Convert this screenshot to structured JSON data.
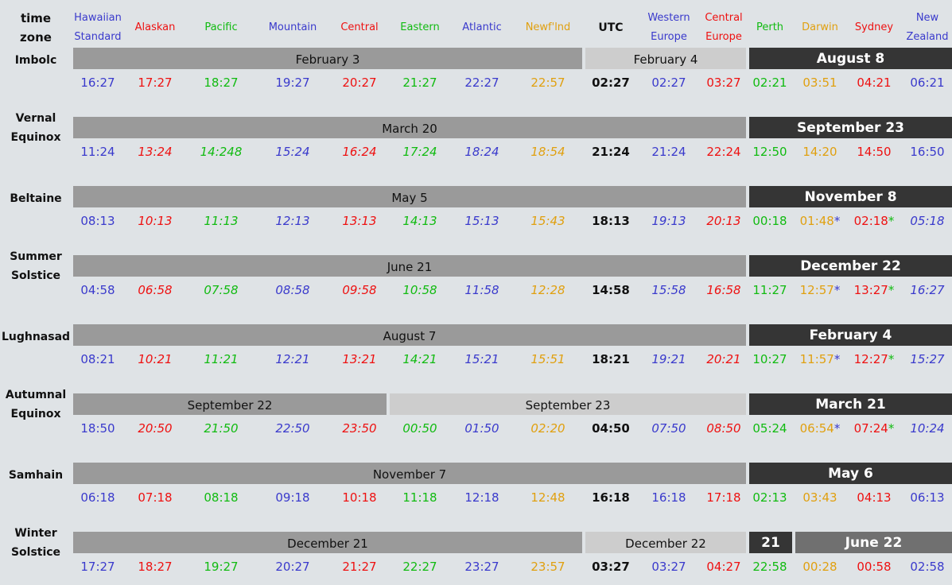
{
  "header": {
    "timezone_label": [
      "time",
      "zone"
    ],
    "columns": [
      {
        "lines": [
          "Hawaiian",
          "Standard"
        ],
        "color": "#3a3acc"
      },
      {
        "lines": [
          "Alaskan"
        ],
        "color": "#ee1111"
      },
      {
        "lines": [
          "Pacific"
        ],
        "color": "#11bb11"
      },
      {
        "lines": [
          "Mountain"
        ],
        "color": "#3a3acc"
      },
      {
        "lines": [
          "Central"
        ],
        "color": "#ee1111"
      },
      {
        "lines": [
          "Eastern"
        ],
        "color": "#11bb11"
      },
      {
        "lines": [
          "Atlantic"
        ],
        "color": "#3a3acc"
      },
      {
        "lines": [
          "Newf'lnd"
        ],
        "color": "#e0a010"
      },
      {
        "lines": [
          "UTC"
        ],
        "color": "#111111"
      },
      {
        "lines": [
          "Western",
          "Europe"
        ],
        "color": "#3a3acc"
      },
      {
        "lines": [
          "Central",
          "Europe"
        ],
        "color": "#ee1111"
      },
      {
        "lines": [
          "Perth"
        ],
        "color": "#11bb11"
      },
      {
        "lines": [
          "Darwin"
        ],
        "color": "#e0a010"
      },
      {
        "lines": [
          "Sydney"
        ],
        "color": "#ee1111"
      },
      {
        "lines": [
          "New",
          "Zealand"
        ],
        "color": "#3a3acc"
      }
    ]
  },
  "colors": {
    "background": "#dfe3e6",
    "bar_mid": "#9a9a9a",
    "bar_light": "#cdcdcd",
    "bar_dark": "#353535",
    "bar_darkmid": "#707070"
  },
  "rows": [
    {
      "label": [
        "Imbolc"
      ],
      "bars": [
        {
          "text": "February 3",
          "style": "mid",
          "span": [
            0,
            7
          ]
        },
        {
          "text": "February 4",
          "style": "light",
          "span": [
            8,
            10
          ]
        },
        {
          "text": "August 8",
          "style": "dark",
          "span": [
            11,
            14
          ]
        }
      ],
      "times": [
        {
          "t": "16:27"
        },
        {
          "t": "17:27"
        },
        {
          "t": "18:27"
        },
        {
          "t": "19:27"
        },
        {
          "t": "20:27"
        },
        {
          "t": "21:27"
        },
        {
          "t": "22:27"
        },
        {
          "t": "22:57"
        },
        {
          "t": "02:27"
        },
        {
          "t": "02:27"
        },
        {
          "t": "03:27"
        },
        {
          "t": "02:21"
        },
        {
          "t": "03:51"
        },
        {
          "t": "04:21"
        },
        {
          "t": "06:21"
        }
      ]
    },
    {
      "label": [
        "Vernal",
        "Equinox"
      ],
      "bars": [
        {
          "text": "March 20",
          "style": "mid",
          "span": [
            0,
            10
          ]
        },
        {
          "text": "September 23",
          "style": "dark",
          "span": [
            11,
            14
          ]
        }
      ],
      "times": [
        {
          "t": "11:24"
        },
        {
          "t": "13:24",
          "i": true
        },
        {
          "t": "14:248",
          "i": true
        },
        {
          "t": "15:24",
          "i": true
        },
        {
          "t": "16:24",
          "i": true
        },
        {
          "t": "17:24",
          "i": true
        },
        {
          "t": "18:24",
          "i": true
        },
        {
          "t": "18:54",
          "i": true
        },
        {
          "t": "21:24"
        },
        {
          "t": "21:24"
        },
        {
          "t": "22:24"
        },
        {
          "t": "12:50"
        },
        {
          "t": "14:20"
        },
        {
          "t": "14:50"
        },
        {
          "t": "16:50"
        }
      ]
    },
    {
      "label": [
        "Beltaine"
      ],
      "bars": [
        {
          "text": "May 5",
          "style": "mid",
          "span": [
            0,
            10
          ]
        },
        {
          "text": "November 8",
          "style": "dark",
          "span": [
            11,
            14
          ]
        }
      ],
      "times": [
        {
          "t": "08:13"
        },
        {
          "t": "10:13",
          "i": true
        },
        {
          "t": "11:13",
          "i": true
        },
        {
          "t": "12:13",
          "i": true
        },
        {
          "t": "13:13",
          "i": true
        },
        {
          "t": "14:13",
          "i": true
        },
        {
          "t": "15:13",
          "i": true
        },
        {
          "t": "15:43",
          "i": true
        },
        {
          "t": "18:13"
        },
        {
          "t": "19:13",
          "i": true
        },
        {
          "t": "20:13",
          "i": true
        },
        {
          "t": "00:18"
        },
        {
          "t": "01:48",
          "s": "*",
          "sc": "#3a3acc"
        },
        {
          "t": "02:18",
          "s": "*",
          "sc": "#11bb11"
        },
        {
          "t": "05:18",
          "i": true
        }
      ]
    },
    {
      "label": [
        "Summer",
        "Solstice"
      ],
      "bars": [
        {
          "text": "June 21",
          "style": "mid",
          "span": [
            0,
            10
          ]
        },
        {
          "text": "December 22",
          "style": "dark",
          "span": [
            11,
            14
          ]
        }
      ],
      "times": [
        {
          "t": "04:58"
        },
        {
          "t": "06:58",
          "i": true
        },
        {
          "t": "07:58",
          "i": true
        },
        {
          "t": "08:58",
          "i": true
        },
        {
          "t": "09:58",
          "i": true
        },
        {
          "t": "10:58",
          "i": true
        },
        {
          "t": "11:58",
          "i": true
        },
        {
          "t": "12:28",
          "i": true
        },
        {
          "t": "14:58"
        },
        {
          "t": "15:58",
          "i": true
        },
        {
          "t": "16:58",
          "i": true
        },
        {
          "t": "11:27"
        },
        {
          "t": "12:57",
          "s": "*",
          "sc": "#3a3acc"
        },
        {
          "t": "13:27",
          "s": "*",
          "sc": "#11bb11"
        },
        {
          "t": "16:27",
          "i": true
        }
      ]
    },
    {
      "label": [
        "Lughnasad"
      ],
      "bars": [
        {
          "text": "August 7",
          "style": "mid",
          "span": [
            0,
            10
          ]
        },
        {
          "text": "February 4",
          "style": "dark",
          "span": [
            11,
            14
          ]
        }
      ],
      "times": [
        {
          "t": "08:21"
        },
        {
          "t": "10:21",
          "i": true
        },
        {
          "t": "11:21",
          "i": true
        },
        {
          "t": "12:21",
          "i": true
        },
        {
          "t": "13:21",
          "i": true
        },
        {
          "t": "14:21",
          "i": true
        },
        {
          "t": "15:21",
          "i": true
        },
        {
          "t": "15:51",
          "i": true
        },
        {
          "t": "18:21"
        },
        {
          "t": "19:21",
          "i": true
        },
        {
          "t": "20:21",
          "i": true
        },
        {
          "t": "10:27"
        },
        {
          "t": "11:57",
          "s": "*",
          "sc": "#3a3acc"
        },
        {
          "t": "12:27",
          "s": "*",
          "sc": "#11bb11"
        },
        {
          "t": "15:27",
          "i": true
        }
      ]
    },
    {
      "label": [
        "Autumnal",
        "Equinox"
      ],
      "bars": [
        {
          "text": "September 22",
          "style": "mid",
          "span": [
            0,
            4
          ]
        },
        {
          "text": "September 23",
          "style": "light",
          "span": [
            5,
            10
          ]
        },
        {
          "text": "March 21",
          "style": "dark",
          "span": [
            11,
            14
          ]
        }
      ],
      "times": [
        {
          "t": "18:50"
        },
        {
          "t": "20:50",
          "i": true
        },
        {
          "t": "21:50",
          "i": true
        },
        {
          "t": "22:50",
          "i": true
        },
        {
          "t": "23:50",
          "i": true
        },
        {
          "t": "00:50",
          "i": true
        },
        {
          "t": "01:50",
          "i": true
        },
        {
          "t": "02:20",
          "i": true
        },
        {
          "t": "04:50"
        },
        {
          "t": "07:50",
          "i": true
        },
        {
          "t": "08:50",
          "i": true
        },
        {
          "t": "05:24"
        },
        {
          "t": "06:54",
          "s": "*",
          "sc": "#3a3acc"
        },
        {
          "t": "07:24",
          "s": "*",
          "sc": "#11bb11"
        },
        {
          "t": "10:24",
          "i": true
        }
      ]
    },
    {
      "label": [
        "Samhain"
      ],
      "bars": [
        {
          "text": "November 7",
          "style": "mid",
          "span": [
            0,
            10
          ]
        },
        {
          "text": "May 6",
          "style": "dark",
          "span": [
            11,
            14
          ]
        }
      ],
      "times": [
        {
          "t": "06:18"
        },
        {
          "t": "07:18"
        },
        {
          "t": "08:18"
        },
        {
          "t": "09:18"
        },
        {
          "t": "10:18"
        },
        {
          "t": "11:18"
        },
        {
          "t": "12:18"
        },
        {
          "t": "12:48"
        },
        {
          "t": "16:18"
        },
        {
          "t": "16:18"
        },
        {
          "t": "17:18"
        },
        {
          "t": "02:13"
        },
        {
          "t": "03:43"
        },
        {
          "t": "04:13"
        },
        {
          "t": "06:13"
        }
      ]
    },
    {
      "label": [
        "Winter",
        "Solstice"
      ],
      "bars": [
        {
          "text": "December 21",
          "style": "mid",
          "span": [
            0,
            7
          ]
        },
        {
          "text": "December 22",
          "style": "light",
          "span": [
            8,
            10
          ]
        },
        {
          "text": "21",
          "style": "dark",
          "span": [
            11,
            11
          ]
        },
        {
          "text": "June 22",
          "style": "darkmid",
          "span": [
            12,
            14
          ]
        }
      ],
      "times": [
        {
          "t": "17:27"
        },
        {
          "t": "18:27"
        },
        {
          "t": "19:27"
        },
        {
          "t": "20:27"
        },
        {
          "t": "21:27"
        },
        {
          "t": "22:27"
        },
        {
          "t": "23:27"
        },
        {
          "t": "23:57"
        },
        {
          "t": "03:27"
        },
        {
          "t": "03:27"
        },
        {
          "t": "04:27"
        },
        {
          "t": "22:58"
        },
        {
          "t": "00:28"
        },
        {
          "t": "00:58"
        },
        {
          "t": "02:58"
        }
      ]
    }
  ]
}
